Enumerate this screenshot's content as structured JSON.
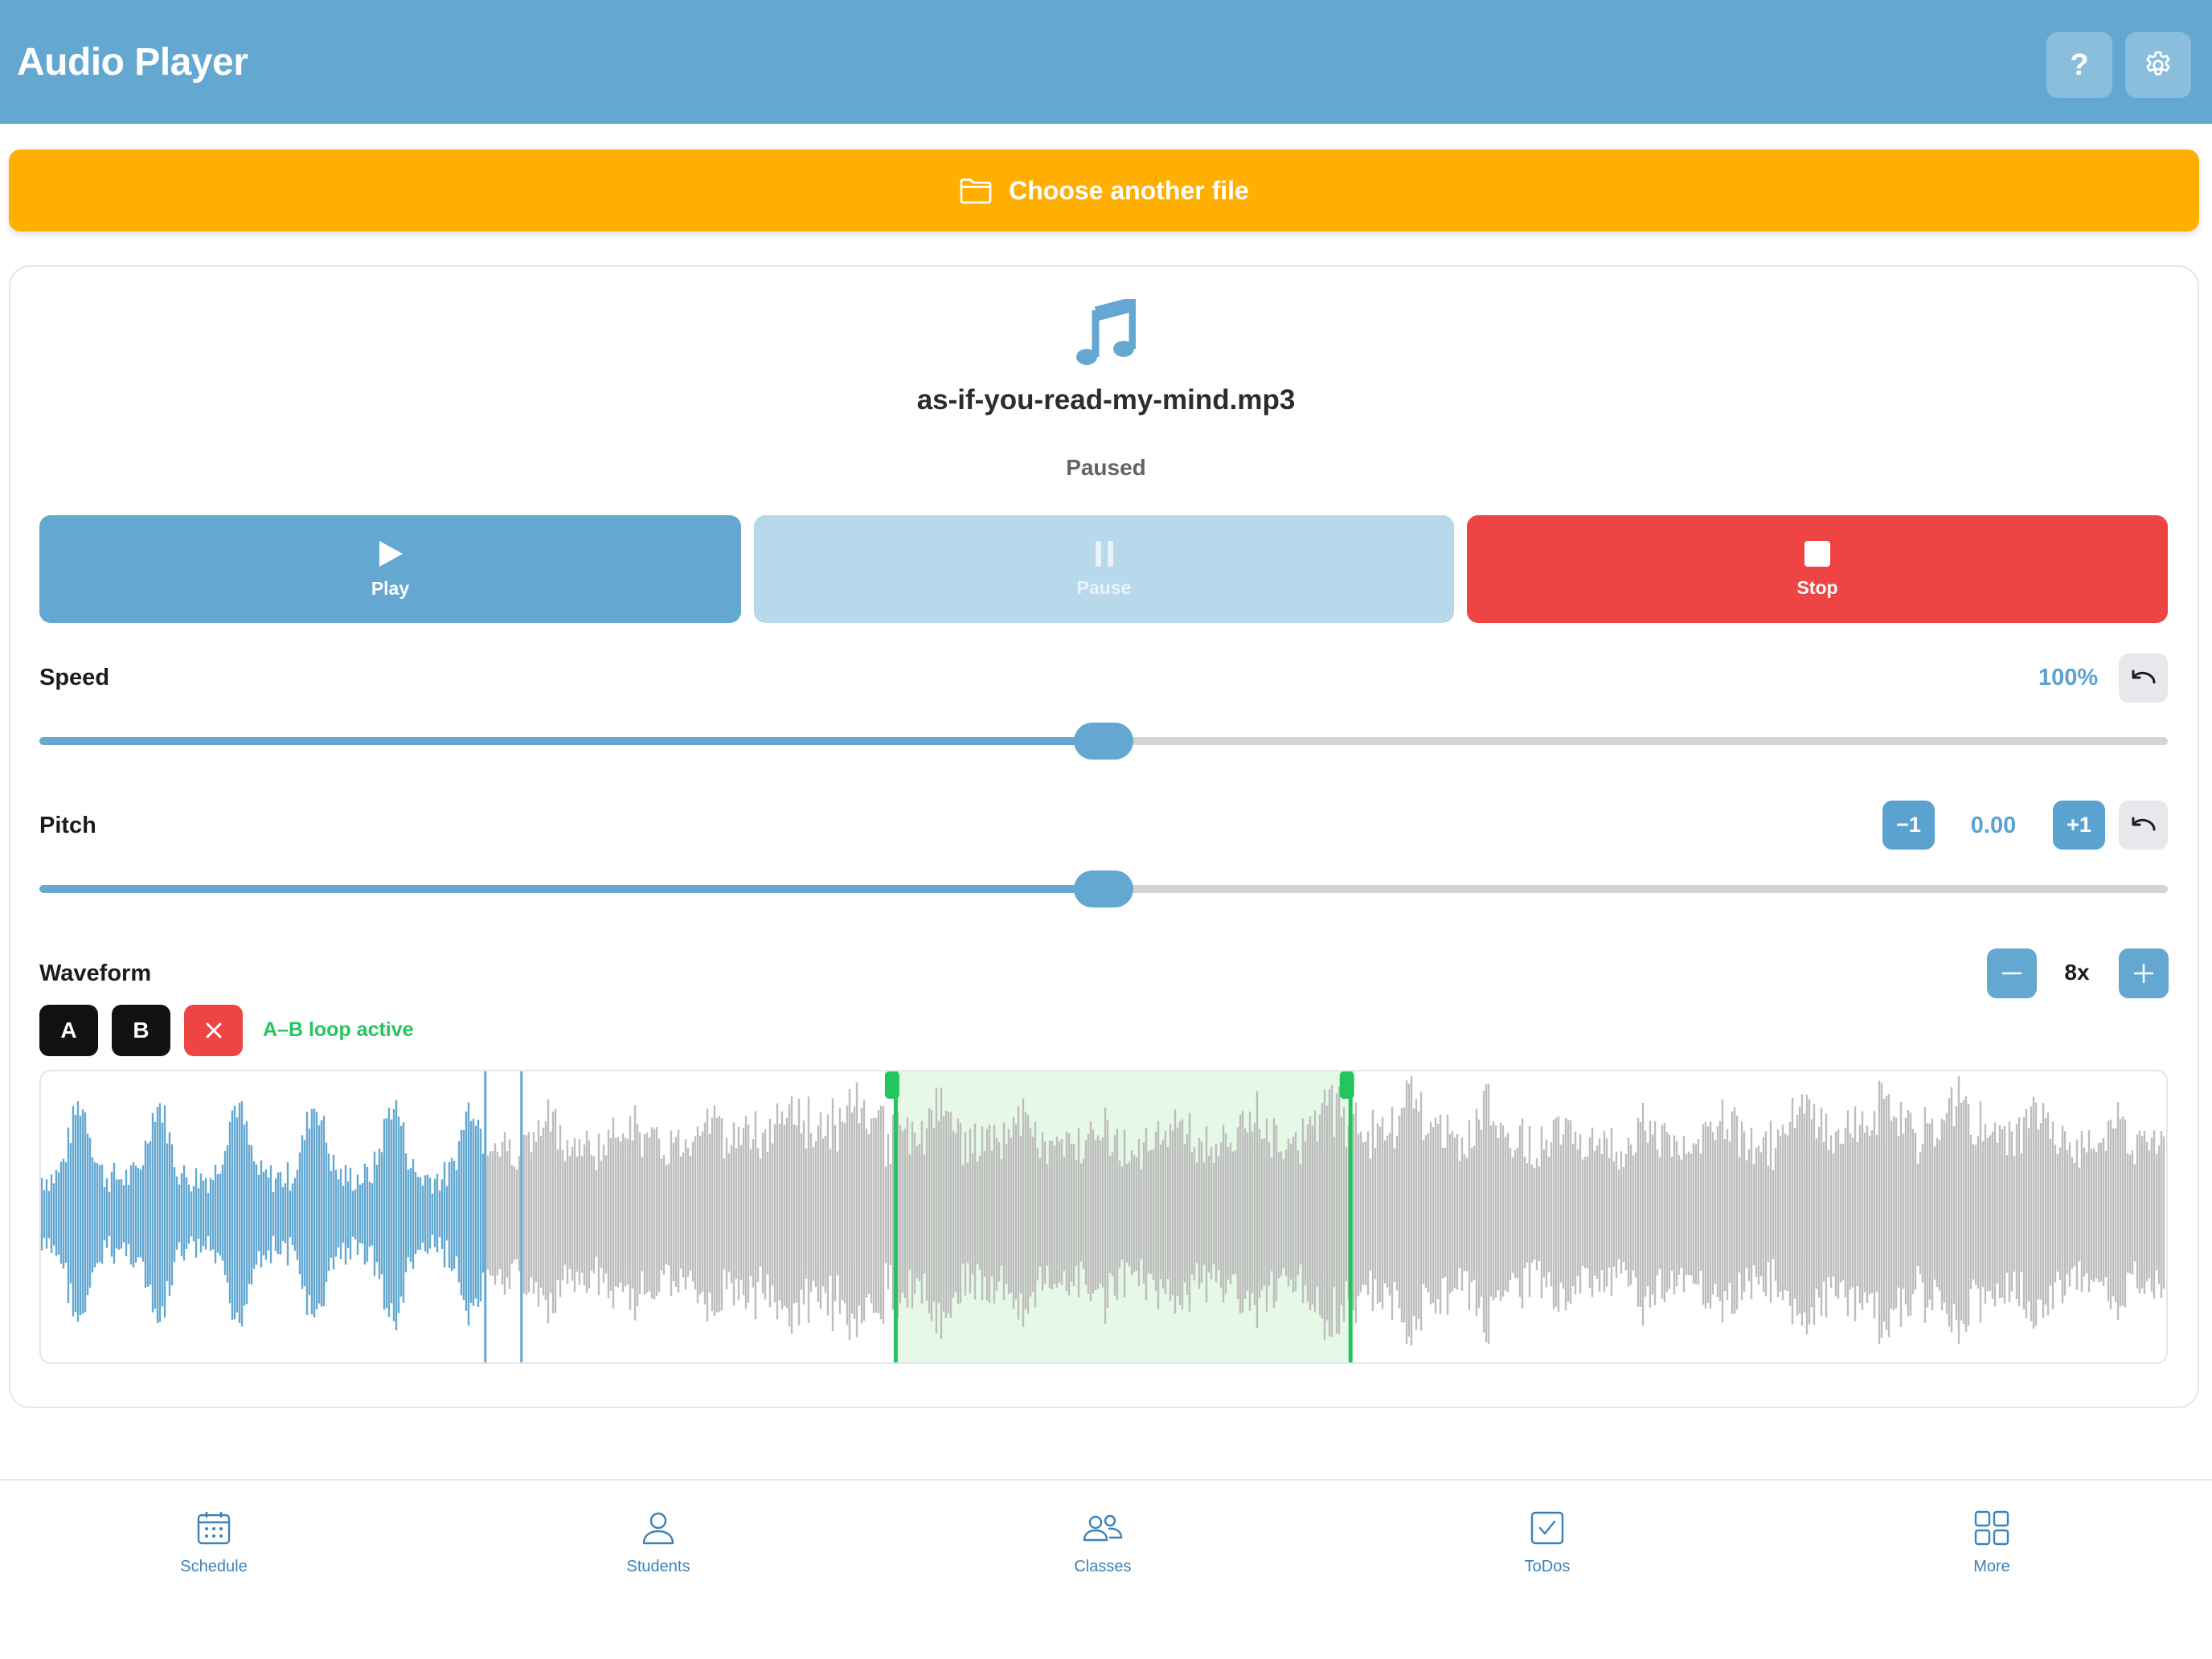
{
  "header": {
    "title": "Audio Player",
    "help_label": "?",
    "settings_icon": "gear-icon"
  },
  "file": {
    "choose_label": "Choose another file",
    "choose_icon": "folder-icon",
    "file_icon": "music-note-icon",
    "name": "as-if-you-read-my-mind.mp3",
    "status": "Paused"
  },
  "transport": {
    "play_label": "Play",
    "pause_label": "Pause",
    "stop_label": "Stop"
  },
  "speed": {
    "label": "Speed",
    "value_text": "100%",
    "level": 0.5
  },
  "pitch": {
    "label": "Pitch",
    "minus_label": "−1",
    "value_text": "0.00",
    "plus_label": "+1",
    "level": 0.5
  },
  "waveform": {
    "label": "Waveform",
    "zoom_text": "8x",
    "a_label": "A",
    "b_label": "B",
    "clear_icon": "close-icon",
    "loop_status": "A–B loop active",
    "played_fraction": 0.21,
    "loop_start_fraction": 0.402,
    "loop_end_fraction": 0.616,
    "colors": {
      "played": "#64a8d2",
      "unplayed": "#bdbdbd",
      "loop_marker": "#22c55e",
      "loop_fill": "#e6f9e6"
    }
  },
  "tabs": [
    {
      "label": "Schedule",
      "icon": "calendar-icon"
    },
    {
      "label": "Students",
      "icon": "person-icon"
    },
    {
      "label": "Classes",
      "icon": "people-icon"
    },
    {
      "label": "ToDos",
      "icon": "checkbox-icon"
    },
    {
      "label": "More",
      "icon": "grid-icon"
    }
  ],
  "colors": {
    "header": "#64a8d2",
    "choose_button": "#ffaf00",
    "stop_button": "#ef4444",
    "accent": "#5aa3d0"
  }
}
